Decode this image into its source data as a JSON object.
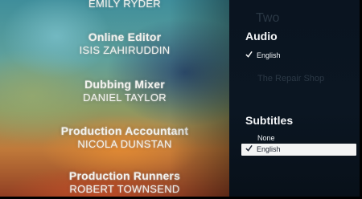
{
  "credits": [
    {
      "role": "",
      "name": "EMILY RYDER"
    },
    {
      "role": "Online Editor",
      "name": "ISIS ZAHIRUDDIN"
    },
    {
      "role": "Dubbing Mixer",
      "name": "DANIEL TAYLOR"
    },
    {
      "role": "Production Accountant",
      "name": "NICOLA DUNSTAN"
    },
    {
      "role": "Production Runners",
      "name": "ROBERT TOWNSEND"
    }
  ],
  "panel": {
    "background_text": {
      "title_small": "Two",
      "subtitle": "The Repair Shop"
    },
    "audio": {
      "title": "Audio",
      "options": [
        {
          "label": "English",
          "checked": true,
          "highlighted": false
        }
      ]
    },
    "subtitles": {
      "title": "Subtitles",
      "options": [
        {
          "label": "None",
          "checked": false,
          "highlighted": false
        },
        {
          "label": "English",
          "checked": true,
          "highlighted": true
        }
      ]
    }
  },
  "colors": {
    "accent_selected_bg": "#f3f4f4",
    "panel_bg": "#0b1622",
    "text": "#f4f6f8"
  },
  "icons": {
    "check": "check-icon"
  }
}
